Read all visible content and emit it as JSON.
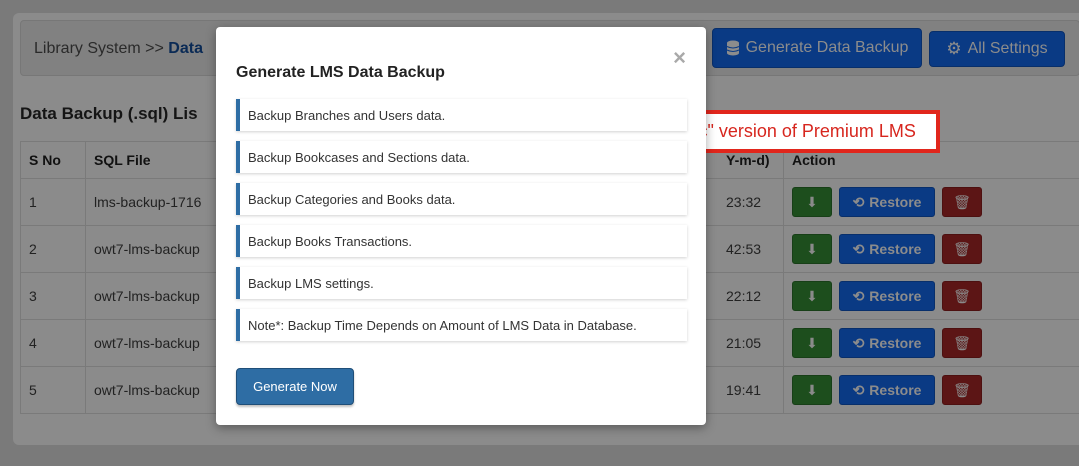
{
  "breadcrumb": {
    "root": "Library System >>",
    "current": "Data"
  },
  "toolbar": {
    "generate_label": "Generate Data Backup",
    "settings_label": "All Settings"
  },
  "list": {
    "title": "Data Backup (.sql) Lis",
    "headers": {
      "sno": "S No",
      "sql": "SQL File",
      "date": "Y-m-d)",
      "action": "Action"
    },
    "rows": [
      {
        "sno": "1",
        "file": "lms-backup-1716",
        "time": "23:32"
      },
      {
        "sno": "2",
        "file": "owt7-lms-backup",
        "time": "42:53"
      },
      {
        "sno": "3",
        "file": "owt7-lms-backup",
        "time": "22:12"
      },
      {
        "sno": "4",
        "file": "owt7-lms-backup",
        "time": "21:05"
      },
      {
        "sno": "5",
        "file": "owt7-lms-backup",
        "time": "19:41"
      }
    ],
    "restore_label": "Restore"
  },
  "annotation": {
    "text": "\"Basic\" version of Premium LMS",
    "color": "#e1261c"
  },
  "modal": {
    "close": "×",
    "title": "Generate LMS Data Backup",
    "items": [
      "Backup Branches and Users data.",
      "Backup Bookcases and Sections data.",
      "Backup Categories and Books data.",
      "Backup Books Transactions.",
      "Backup LMS settings.",
      "Note*: Backup Time Depends on Amount of LMS Data in Database."
    ],
    "button_label": "Generate Now",
    "accent": "#2e6da4"
  }
}
